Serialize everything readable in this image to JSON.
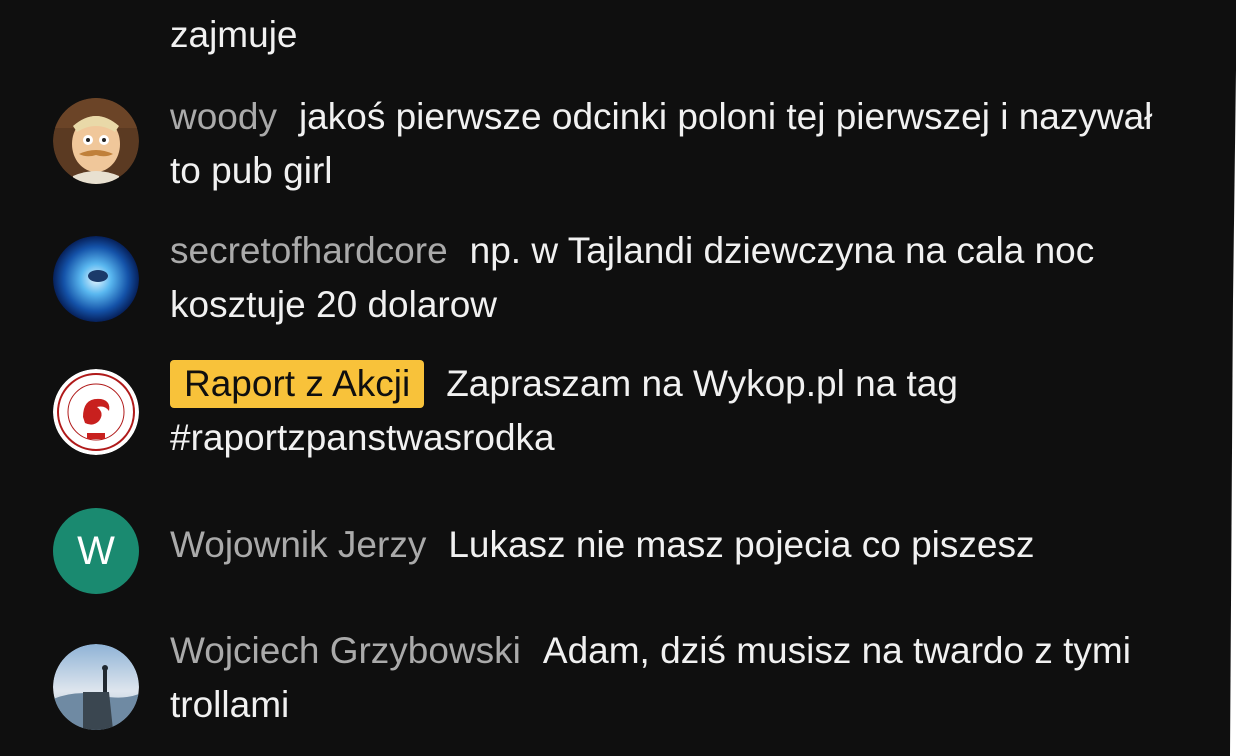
{
  "comments": [
    {
      "message": "zajmuje"
    },
    {
      "author": "woody",
      "message": "jakoś pierwsze odcinki poloni tej pierwszej i nazywał to pub girl"
    },
    {
      "author": "secretofhardcore",
      "message": "np. w Tajlandi dziewczyna na cala noc kosztuje 20 dolarow"
    },
    {
      "author": "Raport z Akcji",
      "author_badge_color": "#f8c23a",
      "message": "Zapraszam na Wykop.pl na tag #raportzpanstwasrodka"
    },
    {
      "author": "Wojownik Jerzy",
      "avatar_letter": "W",
      "avatar_color": "#1a8a70",
      "message": "Lukasz nie masz pojecia co piszesz"
    },
    {
      "author": "Wojciech Grzybowski",
      "message": "Adam, dziś musisz na twardo z tymi trollami"
    }
  ],
  "icons": {
    "woody_avatar": "cartoon-face-avatar",
    "secretofhardcore_avatar": "blue-glow-avatar",
    "raport_avatar": "red-phoenix-seal-avatar",
    "grzybowski_avatar": "mountain-landscape-avatar"
  }
}
